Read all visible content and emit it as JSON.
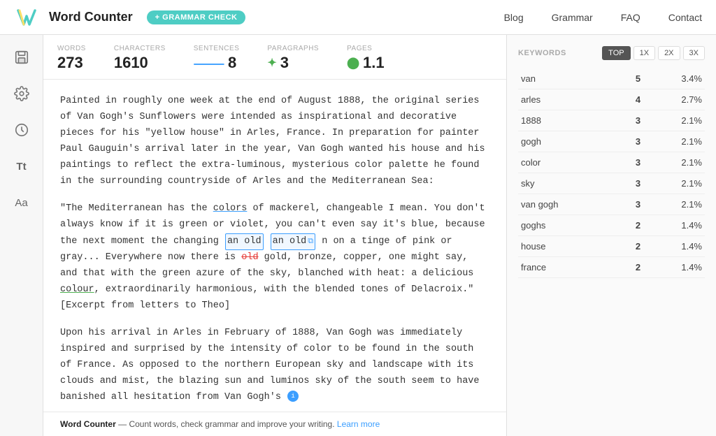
{
  "header": {
    "title": "Word Counter",
    "grammar_check_label": "+ GRAMMAR CHECK",
    "nav": [
      "Blog",
      "Grammar",
      "FAQ",
      "Contact"
    ]
  },
  "stats": {
    "words_label": "WORDS",
    "words_value": "273",
    "characters_label": "CHARACTERS",
    "characters_value": "1610",
    "sentences_label": "SENTENCES",
    "sentences_value": "8",
    "paragraphs_label": "PARAGRAPHS",
    "paragraphs_value": "3",
    "pages_label": "PAGES",
    "pages_value": "1.1"
  },
  "editor": {
    "paragraph1": "Painted in roughly one week at the end of August 1888, the original series of Van Gogh's Sunflowers were intended as inspirational and decorative pieces for his \"yellow house\" in Arles, France. In preparation for painter Paul Gauguin's arrival later in the year, Van Gogh wanted his house and his paintings to reflect the extra-luminous, mysterious color palette he found in the surrounding countryside of Arles and the Mediterranean Sea:",
    "paragraph2_pre": "\"The Mediterranean has the ",
    "paragraph2_colors": "colors",
    "paragraph2_mid1": " of mackerel, changeable I mean. You don't always know if it is green or violet, you can't even say it's blue, because the next moment the changing ",
    "paragraph2_anold1": "an old",
    "paragraph2_anold2": "an old",
    "paragraph2_mid2": " n on a tinge of pink or gray... Everywhere now there is ",
    "paragraph2_old": "old",
    "paragraph2_mid3": " gold, bronze, copper, one might say, and that with the green azure of the sky, blanched with heat: a delicious ",
    "paragraph2_colour": "colour",
    "paragraph2_end": ", extraordinarily harmonious, with the blended tones of Delacroix.\" [Excerpt from letters to Theo]",
    "paragraph3": "Upon his arrival in Arles in February of 1888, Van Gogh was immediately inspired and surprised by the intensity of color to be found in the south of France. As opposed to the northern European sky and landscape with its clouds and mist, the blazing sun and luminos sky of the south seem to have banished all hesitation from Van Gogh's",
    "footer_brand": "Word Counter",
    "footer_separator": " — ",
    "footer_text": "Count words, check grammar and improve your writing. ",
    "footer_link": "Learn more"
  },
  "keywords": {
    "title": "KEYWORDS",
    "tabs": [
      "TOP",
      "1X",
      "2X",
      "3X"
    ],
    "active_tab": "TOP",
    "rows": [
      {
        "word": "van",
        "count": "5",
        "pct": "3.4%"
      },
      {
        "word": "arles",
        "count": "4",
        "pct": "2.7%"
      },
      {
        "word": "1888",
        "count": "3",
        "pct": "2.1%"
      },
      {
        "word": "gogh",
        "count": "3",
        "pct": "2.1%"
      },
      {
        "word": "color",
        "count": "3",
        "pct": "2.1%"
      },
      {
        "word": "sky",
        "count": "3",
        "pct": "2.1%"
      },
      {
        "word": "van gogh",
        "count": "3",
        "pct": "2.1%"
      },
      {
        "word": "goghs",
        "count": "2",
        "pct": "1.4%"
      },
      {
        "word": "house",
        "count": "2",
        "pct": "1.4%"
      },
      {
        "word": "france",
        "count": "2",
        "pct": "1.4%"
      }
    ]
  },
  "icons": {
    "save": "💾",
    "settings": "⚙",
    "clock": "○",
    "font_size": "Tt",
    "font_style": "Aa"
  }
}
